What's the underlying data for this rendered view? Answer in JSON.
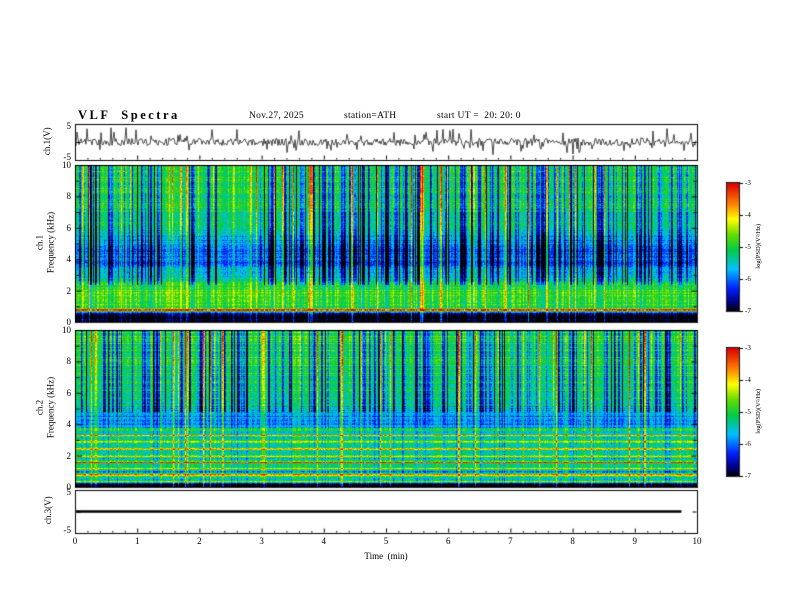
{
  "header": {
    "title": "VLF  Spectra",
    "date": "Nov.27, 2025",
    "station": "station=ATH",
    "start_ut": "start UT =  20: 20: 0"
  },
  "panels": {
    "wave1": {
      "label": "ch.1(V)",
      "yticks": [
        "5",
        "-5"
      ]
    },
    "spec1": {
      "channel": "ch.1",
      "ylabel": "Frequency (kHz)"
    },
    "spec2": {
      "channel": "ch.2",
      "ylabel": "Frequency (kHz)"
    },
    "wave3": {
      "label": "ch.3(V)",
      "yticks": [
        "5",
        "-5"
      ]
    }
  },
  "spec_yticks": [
    "10",
    "8",
    "6",
    "4",
    "2",
    "0"
  ],
  "xaxis": {
    "label": "Time  (min)",
    "ticks": [
      "0",
      "1",
      "2",
      "3",
      "4",
      "5",
      "6",
      "7",
      "8",
      "9",
      "10"
    ]
  },
  "colorbar": {
    "label": "log(PSD)(V²/Hz)",
    "ticks": [
      "-3",
      "-4",
      "-5",
      "-6",
      "-7"
    ],
    "stops": [
      [
        0,
        "#000000"
      ],
      [
        0.07,
        "#000080"
      ],
      [
        0.18,
        "#0020ff"
      ],
      [
        0.33,
        "#00c0ff"
      ],
      [
        0.48,
        "#00cc44"
      ],
      [
        0.6,
        "#66dd00"
      ],
      [
        0.72,
        "#ffff00"
      ],
      [
        0.84,
        "#ff8000"
      ],
      [
        1,
        "#dd0000"
      ]
    ]
  },
  "chart_data": [
    {
      "type": "line",
      "name": "ch.1 voltage waveform",
      "xlabel": "Time (min)",
      "x_range": [
        0,
        10
      ],
      "ylabel": "ch.1(V)",
      "ylim": [
        -5,
        5
      ],
      "features": "zero-mean broadband noise, rms about 1 V, frequent impulsive spikes reaching +/-4 to 5 V across the whole 10 min record",
      "render": {
        "seed": 11,
        "amp": 1.0,
        "spike_rate": 0.12,
        "spike_amp": 3.4
      }
    },
    {
      "type": "heatmap",
      "name": "ch.1 VLF spectrogram",
      "xlabel": "Time (min)",
      "x_range": [
        0,
        10
      ],
      "ylabel": "Frequency (kHz)",
      "y_range": [
        0,
        10
      ],
      "z_label": "log(PSD)(V²/Hz)",
      "z_range": [
        -7,
        -3
      ],
      "profile": [
        [
          0,
          -7
        ],
        [
          0.5,
          -7
        ],
        [
          0.75,
          -5.0
        ],
        [
          1.1,
          -4.75
        ],
        [
          2.2,
          -4.8
        ],
        [
          3.0,
          -5.5
        ],
        [
          3.7,
          -6.0
        ],
        [
          4.6,
          -6.05
        ],
        [
          5.3,
          -5.7
        ],
        [
          6.2,
          -5.3
        ],
        [
          7.5,
          -5.05
        ],
        [
          10,
          -4.95
        ]
      ],
      "lines": [
        {
          "f": 0.8,
          "a": 2.2,
          "w": 0.07
        }
      ],
      "features": "green background near -5; depressed blue band 3-5.5 kHz; black band below 0.6 kHz with narrow emission line near 0.8 kHz; bright yellow-green band 1-2.5 kHz; dense vertical sferic streaks (dark blue and bright yellow/red-topped) spanning 0-10 kHz for the full 10 minutes",
      "render": {
        "seed": 21,
        "impulse_rate": 0.07,
        "dark_rate": 0.26,
        "dark_band": [
          2.4,
          10
        ],
        "pix_noise": 0.55,
        "row_noise": 0.22
      }
    },
    {
      "type": "heatmap",
      "name": "ch.2 VLF spectrogram",
      "xlabel": "Time (min)",
      "x_range": [
        0,
        10
      ],
      "ylabel": "Frequency (kHz)",
      "y_range": [
        0,
        10
      ],
      "z_label": "log(PSD)(V²/Hz)",
      "z_range": [
        -7,
        -3
      ],
      "profile": [
        [
          0,
          -7
        ],
        [
          0.25,
          -6.9
        ],
        [
          0.5,
          -5.3
        ],
        [
          1.0,
          -5.1
        ],
        [
          2.0,
          -5.1
        ],
        [
          3.0,
          -5.15
        ],
        [
          3.6,
          -5.3
        ],
        [
          4.2,
          -5.9
        ],
        [
          4.7,
          -5.6
        ],
        [
          5.4,
          -5.25
        ],
        [
          6.5,
          -5.1
        ],
        [
          8.0,
          -5.0
        ],
        [
          10,
          -4.9
        ]
      ],
      "lines": [
        {
          "f": 0.35,
          "a": 2.1,
          "w": 0.06
        },
        {
          "f": 0.8,
          "a": 1.9,
          "w": 0.06
        },
        {
          "f": 1.2,
          "a": 1.3,
          "w": 0.05
        },
        {
          "f": 1.6,
          "a": 1.7,
          "w": 0.05
        },
        {
          "f": 2.0,
          "a": 1.2,
          "w": 0.05
        },
        {
          "f": 2.45,
          "a": 1.6,
          "w": 0.05
        },
        {
          "f": 2.9,
          "a": 1.1,
          "w": 0.05
        },
        {
          "f": 3.3,
          "a": 1.5,
          "w": 0.05
        },
        {
          "f": 3.7,
          "a": 0.9,
          "w": 0.05
        },
        {
          "f": 1.0,
          "a": -0.6,
          "w": 0.06
        },
        {
          "f": 1.85,
          "a": -0.5,
          "w": 0.06
        },
        {
          "f": 2.7,
          "a": -0.5,
          "w": 0.06
        }
      ],
      "features": "horizontal power-line harmonic stripes (yellow/orange/red) below ~4 kHz persisting all 10 min; darker blue band near 4.2-4.6 kHz; green streaky background 5-10 kHz with vertical sferic streaks; black band below 0.4 kHz containing a bright line near 0.35 kHz",
      "render": {
        "seed": 57,
        "impulse_rate": 0.06,
        "dark_rate": 0.22,
        "dark_band": [
          4.8,
          10
        ],
        "pix_noise": 0.5,
        "row_noise": 0.3
      }
    },
    {
      "type": "line",
      "name": "ch.3 voltage waveform",
      "xlabel": "Time (min)",
      "x_range": [
        0,
        10
      ],
      "ylabel": "ch.3(V)",
      "ylim": [
        -5,
        5
      ],
      "features": "thick flat trace at 0 V from 0 to about 9.75 min (no signal on channel 3)",
      "render": {
        "flat": 0,
        "x_end": 9.75
      }
    }
  ]
}
